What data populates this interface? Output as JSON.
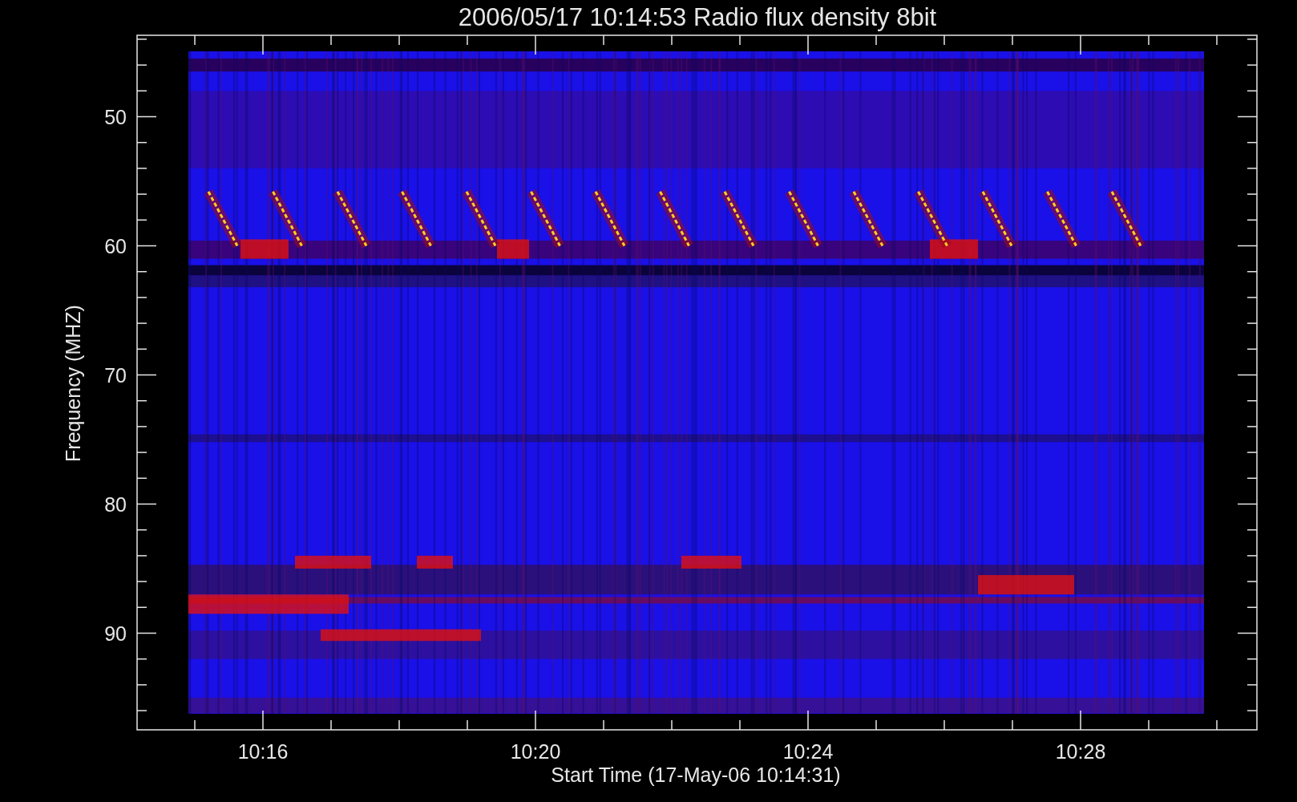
{
  "title": "2006/05/17 10:14:53 Radio flux density 8bit",
  "y_axis": {
    "label": "Frequency (MHZ)",
    "ticks": [
      "50",
      "60",
      "70",
      "80",
      "90"
    ]
  },
  "x_axis": {
    "label": "Start Time (17-May-06 10:14:31)",
    "ticks": [
      "10:16",
      "10:20",
      "10:24",
      "10:28"
    ]
  }
}
